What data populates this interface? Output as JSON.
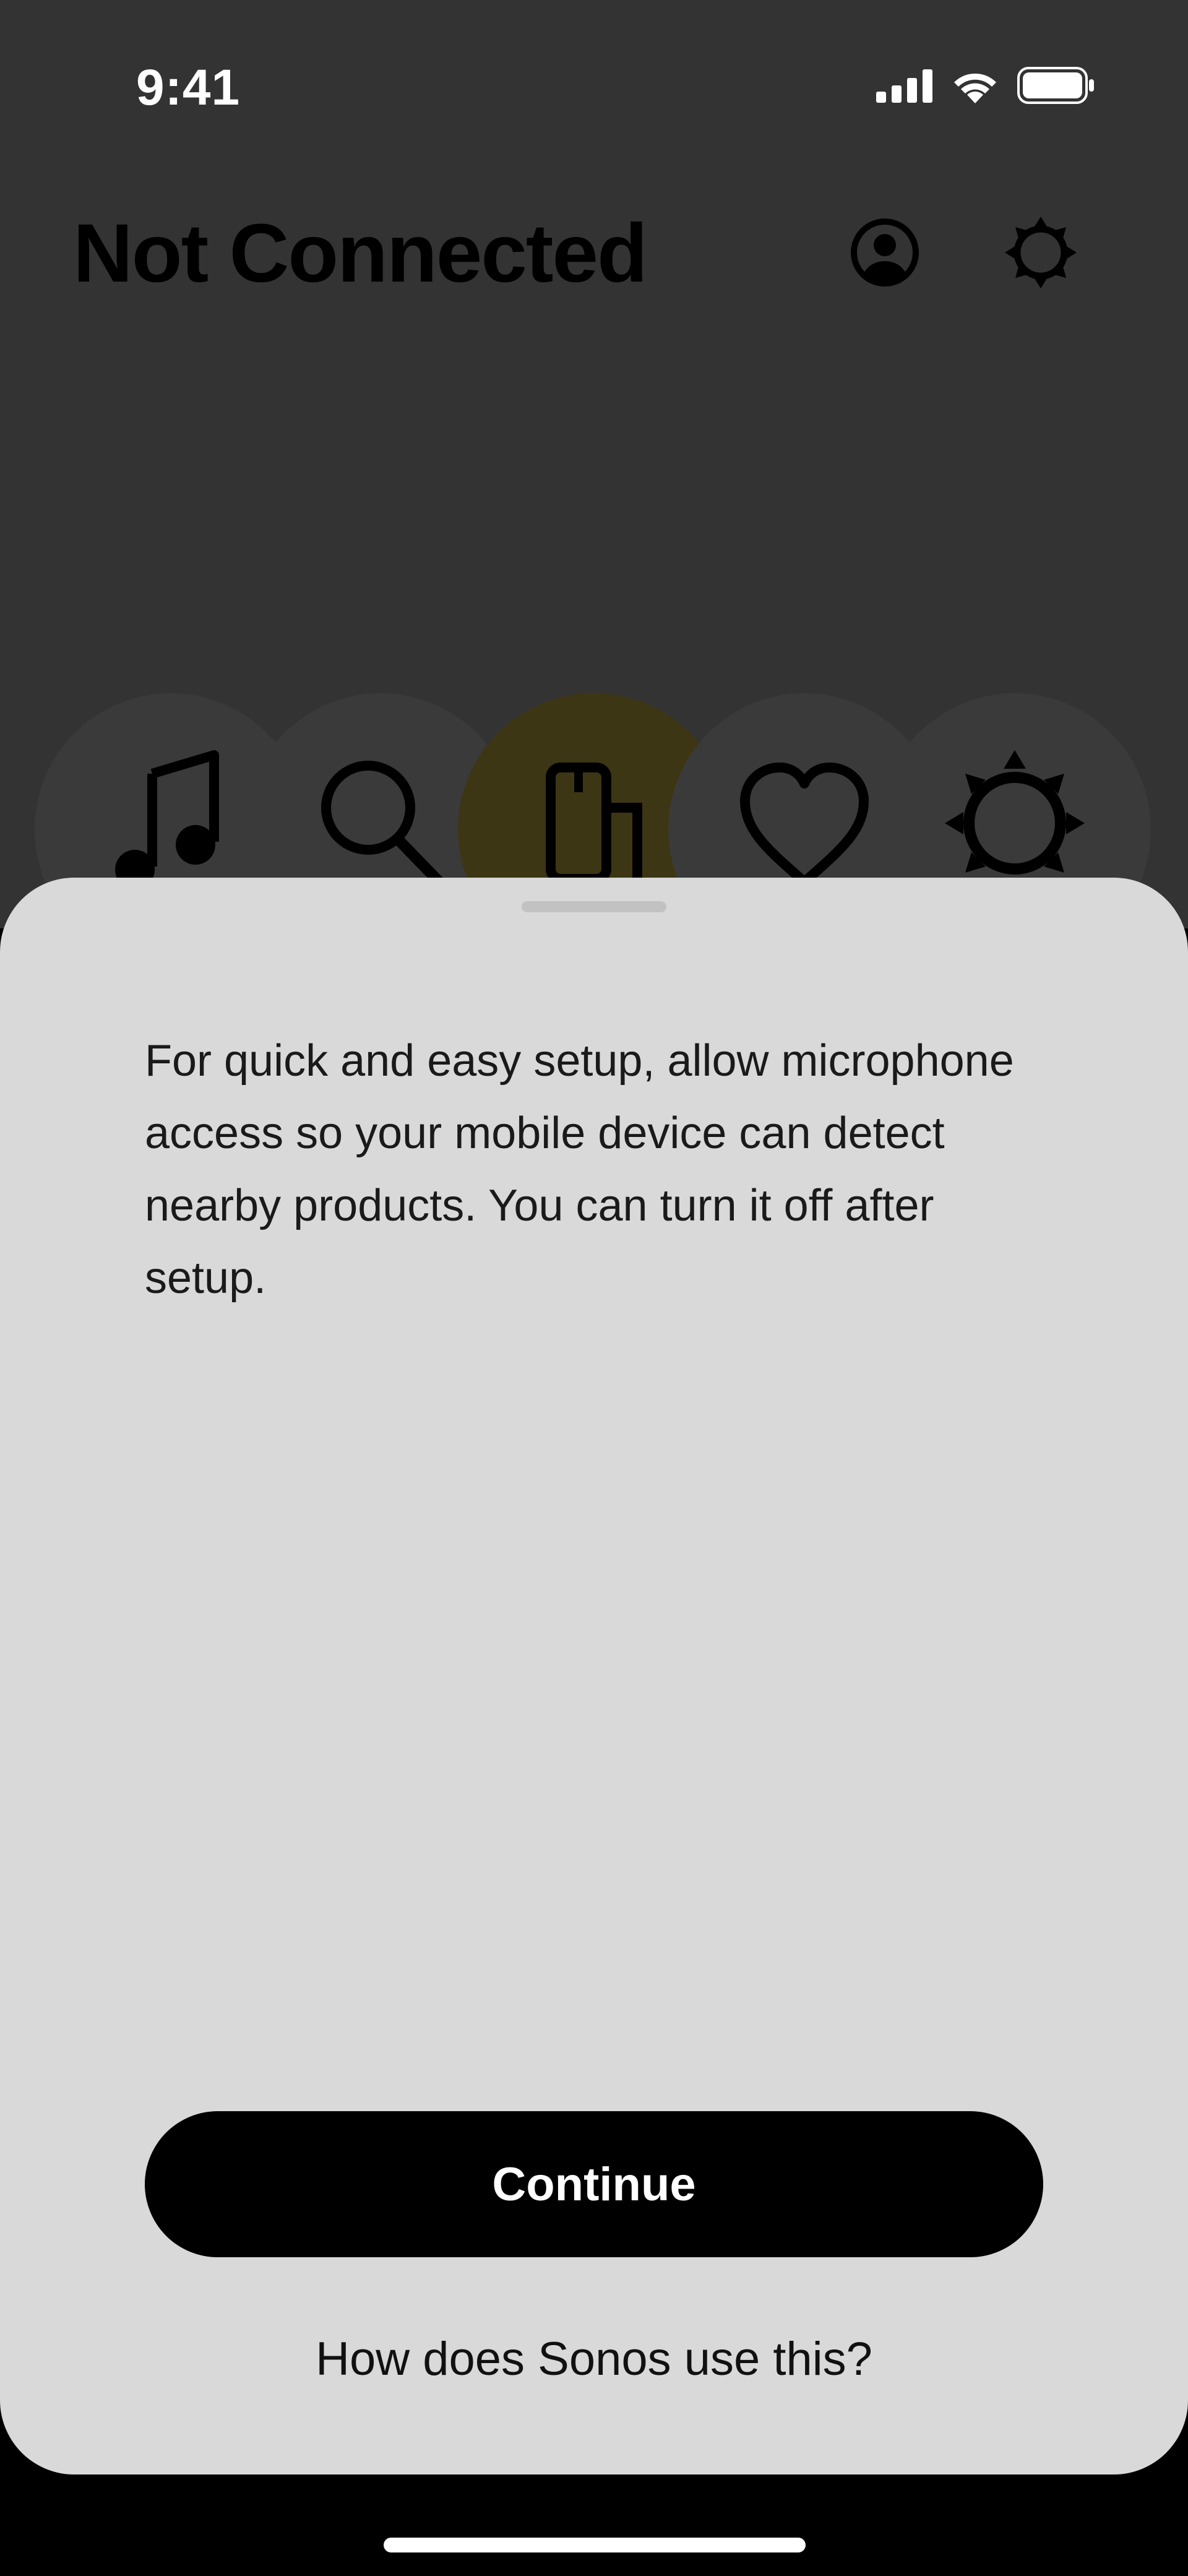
{
  "status_bar": {
    "time": "9:41",
    "icons": [
      "cellular-signal-icon",
      "wifi-icon",
      "battery-icon"
    ]
  },
  "header": {
    "title": "Not Connected",
    "icons": [
      "account-icon",
      "settings-gear-icon"
    ]
  },
  "tabs": [
    {
      "icon": "music-note-icon",
      "active": false
    },
    {
      "icon": "search-icon",
      "active": false
    },
    {
      "icon": "devices-icon",
      "active": true
    },
    {
      "icon": "heart-icon",
      "active": false
    },
    {
      "icon": "settings-icon",
      "active": false
    }
  ],
  "sheet": {
    "message": "For quick and easy setup, allow microphone access so your mobile device can detect nearby products. You can turn it off after setup.",
    "continue_label": "Continue",
    "help_link": "How does Sonos use this?"
  },
  "colors": {
    "background_dim": "#333333",
    "sheet": "#d9d9d9",
    "primary_button": "#000000",
    "active_tab": "#3d3614"
  }
}
